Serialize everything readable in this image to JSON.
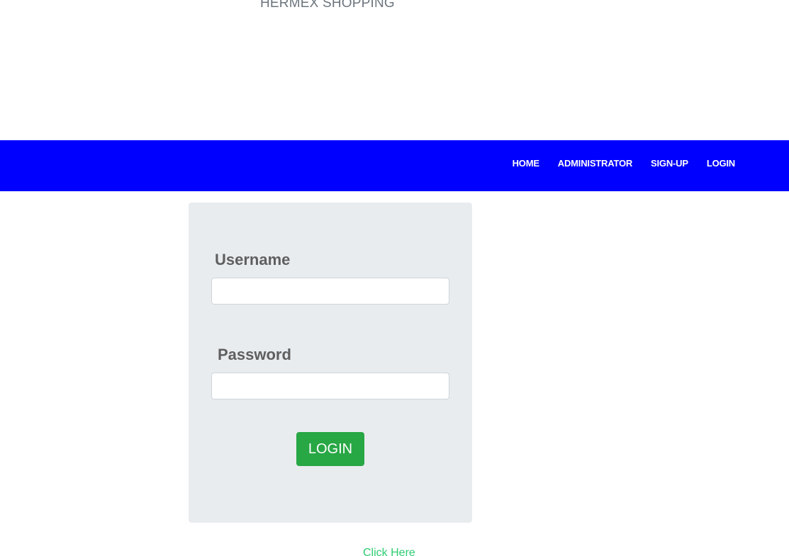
{
  "header": {
    "brand": "HERMEX SHOPPING"
  },
  "navbar": {
    "links": [
      {
        "label": "HOME"
      },
      {
        "label": "ADMINISTRATOR"
      },
      {
        "label": "SIGN-UP"
      },
      {
        "label": "LOGIN"
      }
    ],
    "background_color": "#0000ff"
  },
  "login_form": {
    "username_label": "Username",
    "username_value": "",
    "password_label": "Password",
    "password_value": "",
    "submit_label": "LOGIN",
    "submit_color": "#28a745"
  },
  "footer_link": {
    "label": "Click Here"
  }
}
